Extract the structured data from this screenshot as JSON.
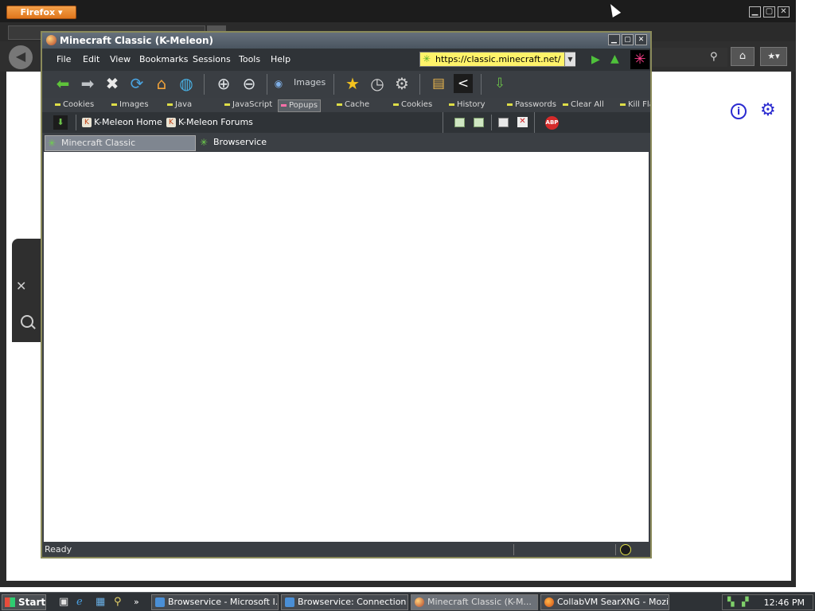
{
  "firefox": {
    "menu_label": "Firefox ▾"
  },
  "kmeleon": {
    "title": "Minecraft Classic (K-Meleon)",
    "menu": [
      "File",
      "Edit",
      "View",
      "Bookmarks",
      "Sessions",
      "Tools",
      "Help"
    ],
    "url": "https://classic.minecraft.net/",
    "toolbar_images_label": "Images",
    "prefbar": [
      "Cookies",
      "Images",
      "Java",
      "JavaScript",
      "Popups",
      "Cache",
      "Cookies",
      "History",
      "Passwords",
      "Clear All",
      "Kill Fla"
    ],
    "bookmarks": [
      "K-Meleon Home",
      "K-Meleon Forums"
    ],
    "tabs": [
      "Minecraft Classic",
      "Browservice"
    ],
    "status": "Ready"
  },
  "taskbar": {
    "start_label": "Start",
    "tasks": [
      "Browservice - Microsoft I...",
      "Browservice: Connection l...",
      "Minecraft Classic (K-M...",
      "CollabVM SearXNG - Mozill..."
    ],
    "clock": "12:46 PM"
  }
}
